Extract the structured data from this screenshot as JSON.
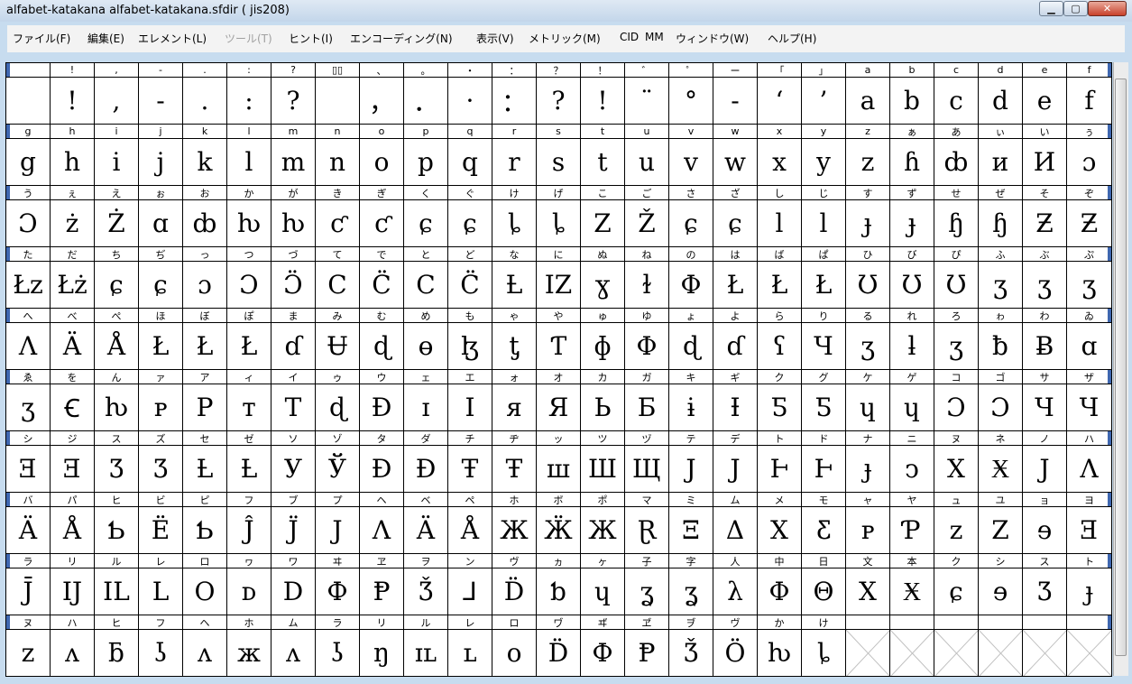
{
  "window": {
    "title": "alfabet-katakana  alfabet-katakana.sfdir ( jis208)",
    "min_icon": "minimize-icon",
    "max_icon": "maximize-icon",
    "close_icon": "close-icon"
  },
  "menu": [
    {
      "label": "ファイル(F)",
      "disabled": false
    },
    {
      "label": "編集(E)",
      "disabled": false
    },
    {
      "label": "エレメント(L)",
      "disabled": false
    },
    {
      "label": "ツール(T)",
      "disabled": true
    },
    {
      "label": "ヒント(I)",
      "disabled": false
    },
    {
      "label": "エンコーディング(N)",
      "disabled": false
    },
    {
      "label": "表示(V)",
      "disabled": false
    },
    {
      "label": "メトリック(M)",
      "disabled": false
    },
    {
      "label": "CID",
      "disabled": false
    },
    {
      "label": "MM",
      "disabled": false
    },
    {
      "label": "ウィンドウ(W)",
      "disabled": false
    },
    {
      "label": "ヘルプ(H)",
      "disabled": false
    }
  ],
  "grid": {
    "columns": 25,
    "rows": [
      {
        "labels": [
          "",
          "!",
          ",",
          "-",
          ".",
          ":",
          "?",
          "▯▯",
          "、",
          "。",
          "・",
          "：",
          "？",
          "！",
          "゛",
          "゜",
          "ー",
          "「",
          "」",
          "a",
          "b",
          "c",
          "d",
          "e",
          "f"
        ],
        "glyphs": [
          "",
          "!",
          ",",
          "-",
          ".",
          ":",
          "?",
          "",
          "，",
          "．",
          "·",
          "：",
          "?",
          "!",
          "¨",
          "°",
          "-",
          "‘",
          "’",
          "a",
          "b",
          "c",
          "d",
          "e",
          "f"
        ]
      },
      {
        "labels": [
          "g",
          "h",
          "i",
          "j",
          "k",
          "l",
          "m",
          "n",
          "o",
          "p",
          "q",
          "r",
          "s",
          "t",
          "u",
          "v",
          "w",
          "x",
          "y",
          "z",
          "ぁ",
          "あ",
          "ぃ",
          "い",
          "ぅ"
        ],
        "glyphs": [
          "g",
          "h",
          "i",
          "j",
          "k",
          "l",
          "m",
          "n",
          "o",
          "p",
          "q",
          "r",
          "s",
          "t",
          "u",
          "v",
          "w",
          "x",
          "y",
          "z",
          "ɦ",
          "ȸ",
          "и",
          "И",
          "ɔ"
        ]
      },
      {
        "labels": [
          "う",
          "ぇ",
          "え",
          "ぉ",
          "お",
          "か",
          "が",
          "き",
          "ぎ",
          "く",
          "ぐ",
          "け",
          "げ",
          "こ",
          "ご",
          "さ",
          "ざ",
          "し",
          "じ",
          "す",
          "ず",
          "せ",
          "ぜ",
          "そ",
          "ぞ"
        ],
        "glyphs": [
          "Ɔ",
          "ż",
          "Ż",
          "ɑ",
          "ȸ",
          "ƕ",
          "ƕ",
          "ƈ",
          "ƈ",
          "ɕ",
          "ɕ",
          "ȴ",
          "ȴ",
          "Z",
          "Ž",
          "ɕ",
          "ɕ",
          "l",
          "l",
          "ɟ",
          "ɟ",
          "ɧ",
          "ɧ",
          "Ƶ",
          "Ƶ"
        ]
      },
      {
        "labels": [
          "た",
          "だ",
          "ち",
          "ぢ",
          "っ",
          "つ",
          "づ",
          "て",
          "で",
          "と",
          "ど",
          "な",
          "に",
          "ぬ",
          "ね",
          "の",
          "は",
          "ば",
          "ぱ",
          "ひ",
          "び",
          "ぴ",
          "ふ",
          "ぶ",
          "ぷ"
        ],
        "glyphs": [
          "Łz",
          "Łż",
          "ɕ",
          "ɕ",
          "ɔ",
          "Ɔ",
          "Ɔ̈",
          "C",
          "C̈",
          "C",
          "C̈",
          "Ƚ",
          "IZ",
          "ɣ",
          "ɫ",
          "Φ",
          "Ł",
          "Ł",
          "Ł",
          "Ʊ",
          "Ʊ",
          "Ʊ",
          "ʒ",
          "ʒ",
          "ʒ"
        ]
      },
      {
        "labels": [
          "へ",
          "べ",
          "ぺ",
          "ほ",
          "ぼ",
          "ぽ",
          "ま",
          "み",
          "む",
          "め",
          "も",
          "ゃ",
          "や",
          "ゅ",
          "ゆ",
          "ょ",
          "よ",
          "ら",
          "り",
          "る",
          "れ",
          "ろ",
          "ゎ",
          "わ",
          "ゐ"
        ],
        "glyphs": [
          "Λ",
          "Ä",
          "Å",
          "Ł",
          "Ł",
          "Ł",
          "ɗ",
          "Ʉ",
          "ɖ",
          "ɵ",
          "ɮ",
          "ƫ",
          "Ƭ",
          "ɸ",
          "Φ",
          "ɖ",
          "ɗ",
          "ʕ",
          "Ч",
          "ʒ",
          "ƚ",
          "ʒ",
          "ƀ",
          "Ƀ",
          "ɑ"
        ]
      },
      {
        "labels": [
          "ゑ",
          "を",
          "ん",
          "ァ",
          "ア",
          "ィ",
          "イ",
          "ゥ",
          "ウ",
          "ェ",
          "エ",
          "ォ",
          "オ",
          "カ",
          "ガ",
          "キ",
          "ギ",
          "ク",
          "グ",
          "ケ",
          "ゲ",
          "コ",
          "ゴ",
          "サ",
          "ザ"
        ],
        "glyphs": [
          "ʒ",
          "Ꞓ",
          "ƕ",
          "ᴘ",
          "P",
          "ᴛ",
          "T",
          "ɖ",
          "Ð",
          "ɪ",
          "I",
          "я",
          "Я",
          "Ь",
          "Ƃ",
          "ɨ",
          "Ɨ",
          "Ƽ",
          "Ƽ",
          "ɥ",
          "ɥ",
          "Ɔ",
          "Ɔ",
          "Ч",
          "Ч"
        ]
      },
      {
        "labels": [
          "シ",
          "ジ",
          "ス",
          "ズ",
          "セ",
          "ゼ",
          "ソ",
          "ゾ",
          "タ",
          "ダ",
          "チ",
          "ヂ",
          "ッ",
          "ツ",
          "ヅ",
          "テ",
          "デ",
          "ト",
          "ド",
          "ナ",
          "ニ",
          "ヌ",
          "ネ",
          "ノ",
          "ハ"
        ],
        "glyphs": [
          "Ǝ",
          "Ǝ",
          "Ʒ",
          "Ʒ",
          "Ƚ",
          "Ƚ",
          "У",
          "Ў",
          "Ð",
          "Ð",
          "Ŧ",
          "Ŧ",
          "ш",
          "Ш",
          "Щ",
          "J",
          "J",
          "Ͱ",
          "Ͱ",
          "ɟ",
          "ↄ",
          "X",
          "Ӿ",
          "J",
          "Λ"
        ]
      },
      {
        "labels": [
          "バ",
          "パ",
          "ヒ",
          "ビ",
          "ピ",
          "フ",
          "ブ",
          "プ",
          "ヘ",
          "ベ",
          "ペ",
          "ホ",
          "ボ",
          "ポ",
          "マ",
          "ミ",
          "ム",
          "メ",
          "モ",
          "ャ",
          "ヤ",
          "ュ",
          "ユ",
          "ョ",
          "ヨ"
        ],
        "glyphs": [
          "Ä",
          "Å",
          "Ƅ",
          "Ë",
          "Ƅ",
          "Ĵ",
          "J̈",
          "J",
          "Λ",
          "Ä",
          "Å",
          "Ж",
          "Ӝ",
          "Ж",
          "Ɽ",
          "Ξ",
          "Δ",
          "X",
          "Ƹ",
          "ᴩ",
          "Ƥ",
          "z",
          "Z",
          "ɘ",
          "Ǝ"
        ]
      },
      {
        "labels": [
          "ラ",
          "リ",
          "ル",
          "レ",
          "ロ",
          "ヮ",
          "ワ",
          "ヰ",
          "ヱ",
          "ヲ",
          "ン",
          "ヴ",
          "ヵ",
          "ヶ",
          "子",
          "字",
          "人",
          "中",
          "日",
          "文",
          "本",
          "ク",
          "シ",
          "ス",
          "ト"
        ],
        "glyphs": [
          "J̄",
          "IJ",
          "IL",
          "L",
          "O",
          "ᴅ",
          "D",
          "Ф",
          "Ᵽ",
          "Ǯ",
          "⅃",
          "D̈",
          "ƅ",
          "ɥ",
          "ʓ",
          "ʓ",
          "λ",
          "Φ",
          "Θ",
          "X",
          "Ӿ",
          "ɕ",
          "ɘ",
          "Ʒ",
          "ɟ"
        ]
      },
      {
        "labels": [
          "ヌ",
          "ハ",
          "ヒ",
          "フ",
          "ヘ",
          "ホ",
          "ム",
          "ラ",
          "リ",
          "ル",
          "レ",
          "ロ",
          "ヷ",
          "ヸ",
          "ヹ",
          "ヺ",
          "ヴ",
          "か",
          "け",
          "",
          "",
          "",
          "",
          "",
          ""
        ],
        "glyphs": [
          "ᴢ",
          "ʌ",
          "ƃ",
          "ʖ",
          "ʌ",
          "ж",
          "ᴧ",
          "ʖ",
          "ŋ",
          "ɪʟ",
          "ʟ",
          "ᴏ",
          "D̈",
          "Ф",
          "Ᵽ",
          "Ǯ",
          "Ö",
          "ƕ",
          "ȴ",
          "",
          "",
          "",
          "",
          "",
          ""
        ]
      }
    ]
  }
}
